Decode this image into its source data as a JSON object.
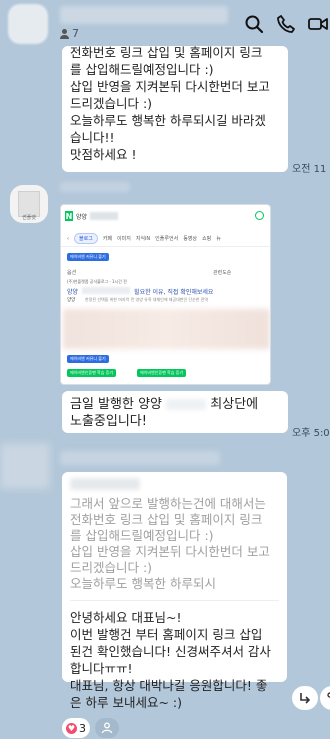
{
  "header": {
    "member_count": "7",
    "icons": [
      "search-icon",
      "phone-icon",
      "video-icon"
    ]
  },
  "messages": {
    "first": {
      "lines": [
        "전화번호 링크 삽입 및 홈페이지 링크",
        "를 삽입해드릴예정입니다 :)",
        "삽입 반영을 지켜본뒤 다시한번더 보고",
        "드리겠습니다 :)",
        "오늘하루도 행복한 하루되시길 바라겠",
        "습니다!!",
        "맛점하세요 !"
      ],
      "time": "오전 11"
    },
    "image": {
      "sender_avatar_label": "썬플랫",
      "query": "양양",
      "tabs": [
        "블로그",
        "카페",
        "이미지",
        "지식iN",
        "인플루언서",
        "동영상",
        "쇼핑",
        "뉴"
      ],
      "chip_top": "에이비앤 커뮤니 볼기",
      "sort_label": "옵션",
      "related_label": "관련도순",
      "source_text": "(주)썬플랫폼 공식블로그 · 1시간 전",
      "title_prefix": "양양",
      "title_suffix": "힐요한 이유, 직접 확인해보세요",
      "snippet_label": "양양",
      "snippet_text": "한정된 선택을 위한 머지막 런 영양 유직 대체인에 제공대변인 단순한 전역",
      "chip_bottom_1": "에이비앤 커뮤니 볼기",
      "chip_green_1": "에이비앤인증팬 학습 증기",
      "chip_green_2": "에이비앤인증팬 학습 증기"
    },
    "second": {
      "prefix": "금일 발행한 양양",
      "suffix": "최상단에",
      "line2": "노출중입니다!",
      "time": "오후 5:0"
    },
    "reply": {
      "quote_lines": [
        "그래서 앞으로 발행하는건에 대해서는",
        "전화번호 링크 삽입 및 홈페이지 링크",
        "를 삽입해드릴예정입니다 :)",
        "삽입 반영을 지켜본뒤 다시한번더 보고",
        "드리겠습니다 :)",
        "오늘하루도 행복한 하루되시"
      ],
      "reply_lines": [
        "안녕하세요 대표님~!",
        "이번 발행건 부터 홈페이지 링크 삽입",
        "된건 확인했습니다! 신경써주셔서 감사",
        "합니다ㅠㅠ!",
        "대표님, 항상 대박나길 응원합니다! 좋",
        "은 하루 보내세요~ :)"
      ]
    }
  },
  "reactions": {
    "heart_count": "3"
  },
  "colors": {
    "background": "#b2c7d9",
    "naver_green": "#03c75a",
    "heart": "#f04e6e"
  }
}
